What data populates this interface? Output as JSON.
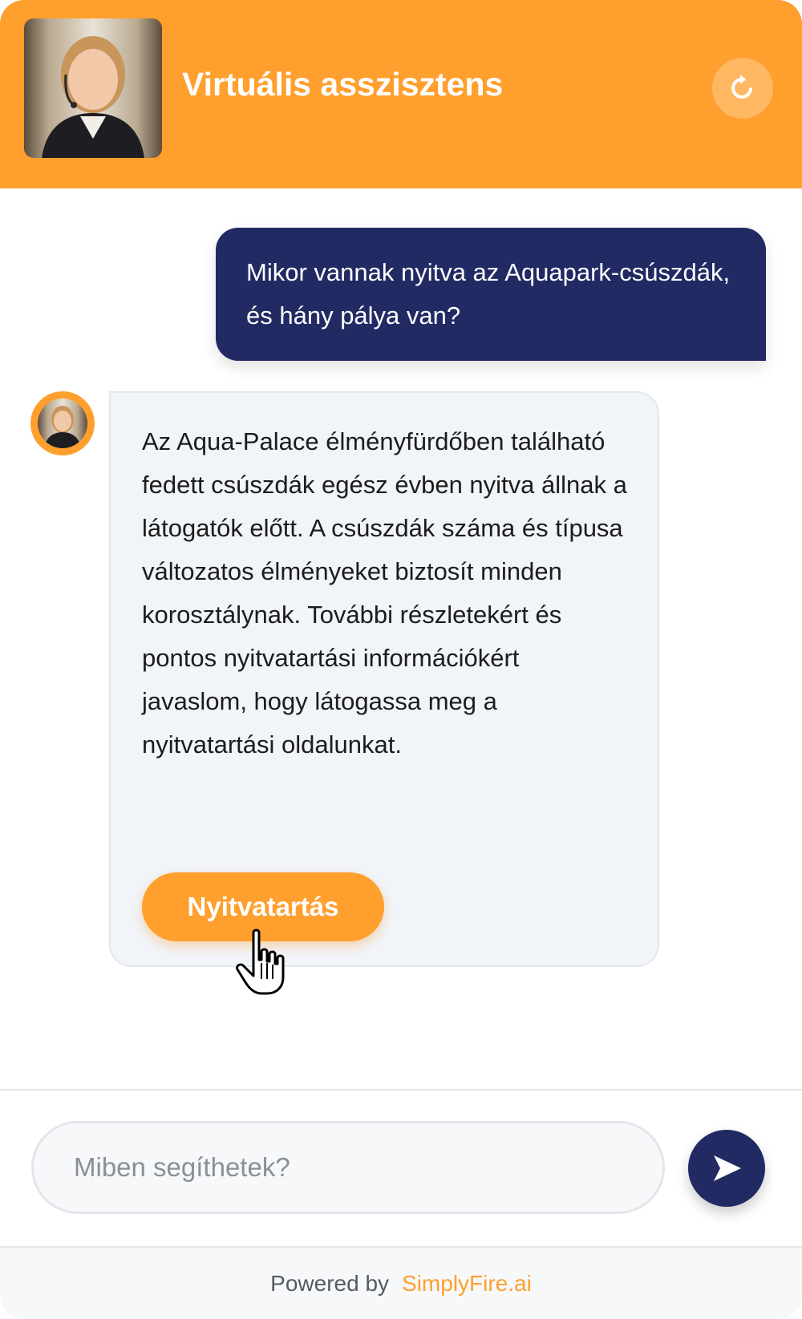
{
  "header": {
    "title": "Virtuális asszisztens",
    "refresh_icon": "refresh-icon",
    "avatar_icon": "assistant-avatar"
  },
  "messages": {
    "user": "Mikor vannak nyitva az Aquapark-csúszdák, és hány pálya van?",
    "bot": "Az Aqua-Palace élményfürdőben található fedett csúszdák egész évben nyitva állnak a látogatók előtt. A csúszdák száma és típusa változatos élményeket biztosít minden korosztálynak. További részletekért és pontos nyitvatartási információkért javaslom, hogy látogassa meg a nyitvatartási oldalunkat.",
    "bot_button_label": "Nyitvatartás"
  },
  "composer": {
    "placeholder": "Miben segíthetek?",
    "value": "",
    "send_icon": "send-icon"
  },
  "footer": {
    "powered_by": "Powered by",
    "brand": "SimplyFire.ai"
  },
  "colors": {
    "accent": "#ff9f2e",
    "navy": "#212a63",
    "bot_bubble": "#f1f4f8"
  }
}
